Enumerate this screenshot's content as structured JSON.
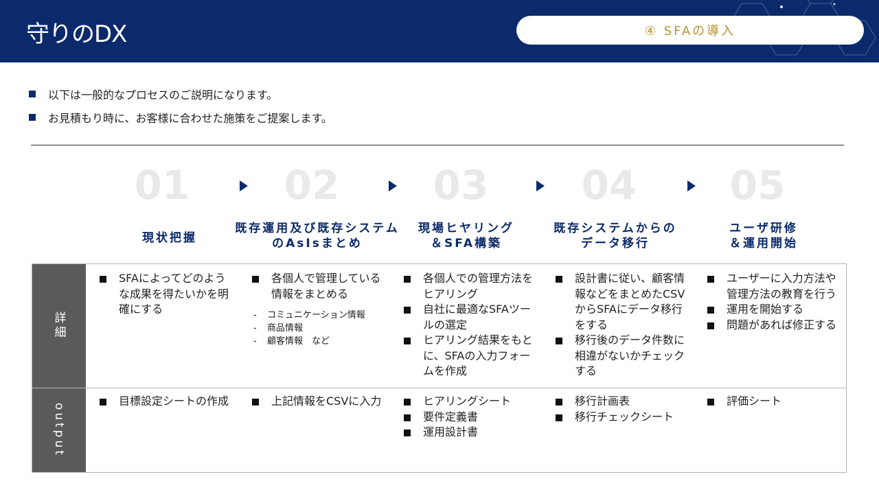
{
  "header": {
    "title": "守りのDX",
    "badge": "④ SFAの導入",
    "bg_color": "#0b2a6b",
    "badge_color": "#b8922d"
  },
  "bullets": [
    "以下は一般的なプロセスのご説明になります。",
    "お見積もり時に、お客様に合わせた施策をご提案します。"
  ],
  "steps": [
    {
      "num": "01",
      "title": "現状把握"
    },
    {
      "num": "02",
      "title": "既存運用及び既存システム\nのAsIsまとめ"
    },
    {
      "num": "03",
      "title": "現場ヒヤリング\n＆SFA構築"
    },
    {
      "num": "04",
      "title": "既存システムからの\nデータ移行"
    },
    {
      "num": "05",
      "title": "ユーザ研修\n＆運用開始"
    }
  ],
  "table": {
    "row_labels": [
      "詳細",
      "output"
    ],
    "details": [
      {
        "items": [
          "SFAによってどのような成果を得たいかを明確にする"
        ],
        "subitems": []
      },
      {
        "items": [
          "各個人で管理している情報をまとめる"
        ],
        "subitems": [
          "コミュニケーション情報",
          "商品情報",
          "顧客情報　など"
        ]
      },
      {
        "items": [
          "各個人での管理方法をヒアリング",
          "自社に最適なSFAツールの選定",
          "ヒアリング結果をもとに、SFAの入力フォームを作成"
        ],
        "subitems": []
      },
      {
        "items": [
          "設計書に従い、顧客情報などをまとめたCSVからSFAにデータ移行をする",
          "移行後のデータ件数に相違がないかチェックする"
        ],
        "subitems": []
      },
      {
        "items": [
          "ユーザーに入力方法や管理方法の教育を行う",
          "運用を開始する",
          "問題があれば修正する"
        ],
        "subitems": []
      }
    ],
    "outputs": [
      {
        "items": [
          "目標設定シートの作成"
        ]
      },
      {
        "items": [
          "上記情報をCSVに入力"
        ]
      },
      {
        "items": [
          "ヒアリングシート",
          "要件定義書",
          "運用設計書"
        ]
      },
      {
        "items": [
          "移行計画表",
          "移行チェックシート"
        ]
      },
      {
        "items": [
          "評価シート"
        ]
      }
    ]
  }
}
